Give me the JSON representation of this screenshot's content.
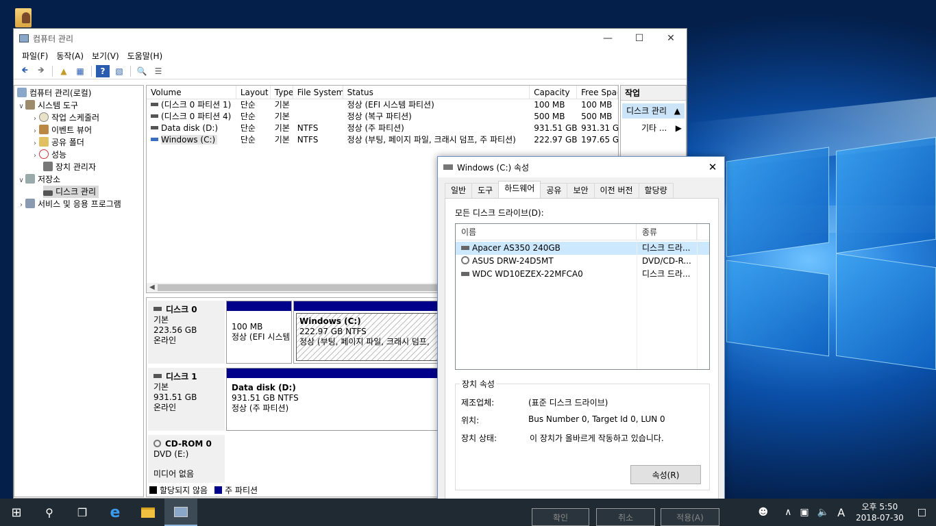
{
  "window": {
    "title": "컴퓨터 관리",
    "menu": [
      "파일(F)",
      "동작(A)",
      "보기(V)",
      "도움말(H)"
    ],
    "tree": [
      {
        "label": "컴퓨터 관리(로컬)",
        "level": 0
      },
      {
        "label": "시스템 도구",
        "level": 1
      },
      {
        "label": "작업 스케줄러",
        "level": 2
      },
      {
        "label": "이벤트 뷰어",
        "level": 2
      },
      {
        "label": "공유 폴더",
        "level": 2
      },
      {
        "label": "성능",
        "level": 2
      },
      {
        "label": "장치 관리자",
        "level": 2
      },
      {
        "label": "저장소",
        "level": 1
      },
      {
        "label": "디스크 관리",
        "level": 2
      },
      {
        "label": "서비스 및 응용 프로그램",
        "level": 1
      }
    ],
    "columns": [
      "Volume",
      "Layout",
      "Type",
      "File System",
      "Status",
      "Capacity",
      "Free Spac"
    ],
    "volumes": [
      [
        "(디스크 0 파티션 1)",
        "단순",
        "기본",
        "",
        "정상 (EFI 시스템 파티션)",
        "100 MB",
        "100 MB"
      ],
      [
        "(디스크 0 파티션 4)",
        "단순",
        "기본",
        "",
        "정상 (복구 파티션)",
        "500 MB",
        "500 MB"
      ],
      [
        "Data disk (D:)",
        "단순",
        "기본",
        "NTFS",
        "정상 (주 파티션)",
        "931.51 GB",
        "931.31 G"
      ],
      [
        "Windows (C:)",
        "단순",
        "기본",
        "NTFS",
        "정상 (부팅, 페이지 파일, 크래시 덤프, 주 파티션)",
        "222.97 GB",
        "197.65 G"
      ]
    ],
    "actions": {
      "header": "작업",
      "selected": "디스크 관리",
      "sub": "기타 ..."
    },
    "disks": [
      {
        "name": "디스크 0",
        "type": "기본",
        "size": "223.56 GB",
        "state": "온라인",
        "parts": [
          {
            "line1": "100 MB",
            "line2": "정상 (EFI 시스템"
          },
          {
            "title": "Windows  (C:)",
            "line1": "222.97 GB NTFS",
            "line2": "정상 (부팅, 페이지 파일, 크래시 덤프,"
          }
        ]
      },
      {
        "name": "디스크 1",
        "type": "기본",
        "size": "931.51 GB",
        "state": "온라인",
        "parts": [
          {
            "title": "Data disk  (D:)",
            "line1": "931.51 GB NTFS",
            "line2": "정상 (주 파티션)"
          }
        ]
      },
      {
        "name": "CD-ROM 0",
        "type": "DVD (E:)",
        "state": "미디어 없음"
      }
    ],
    "legend": {
      "unallocated": "할당되지 않음",
      "primary": "주 파티션"
    }
  },
  "dialog": {
    "title": "Windows (C:) 속성",
    "tabs": [
      "일반",
      "도구",
      "하드웨어",
      "공유",
      "보안",
      "이전 버전",
      "할당량"
    ],
    "active_tab": "하드웨어",
    "all_drives_label": "모든 디스크 드라이브(D):",
    "list_columns": [
      "이름",
      "종류"
    ],
    "drives": [
      {
        "name": "Apacer AS350 240GB",
        "type": "디스크 드라..."
      },
      {
        "name": "ASUS DRW-24D5MT",
        "type": "DVD/CD-R..."
      },
      {
        "name": "WDC WD10EZEX-22MFCA0",
        "type": "디스크 드라..."
      }
    ],
    "props_group": "장치 속성",
    "manufacturer_label": "제조업체:",
    "manufacturer": "(표준 디스크 드라이브)",
    "location_label": "위치:",
    "location": "Bus Number 0, Target Id 0, LUN 0",
    "status_label": "장치 상태:",
    "status": "이 장치가 올바르게 작동하고 있습니다.",
    "properties_button": "속성(R)",
    "ok": "확인",
    "cancel": "취소",
    "apply": "적용(A)"
  },
  "taskbar": {
    "ime": "A",
    "time": "오후 5:50",
    "date": "2018-07-30"
  },
  "colors": {
    "primary_partition": "#00008b",
    "selection": "#cce8ff",
    "taskbar": "#1f2a33"
  }
}
